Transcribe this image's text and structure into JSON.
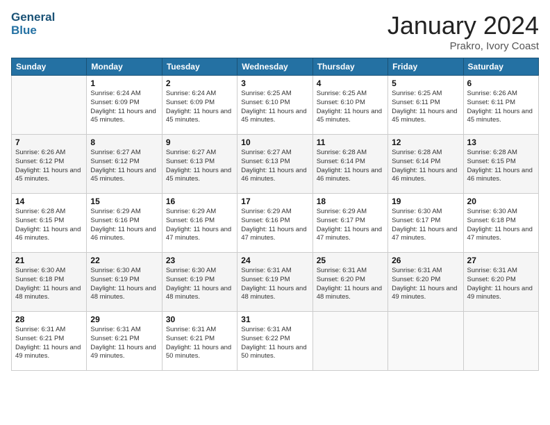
{
  "header": {
    "logo_line1": "General",
    "logo_line2": "Blue",
    "month_title": "January 2024",
    "subtitle": "Prakro, Ivory Coast"
  },
  "columns": [
    "Sunday",
    "Monday",
    "Tuesday",
    "Wednesday",
    "Thursday",
    "Friday",
    "Saturday"
  ],
  "weeks": [
    [
      {
        "day": "",
        "info": ""
      },
      {
        "day": "1",
        "info": "Sunrise: 6:24 AM\nSunset: 6:09 PM\nDaylight: 11 hours and 45 minutes."
      },
      {
        "day": "2",
        "info": "Sunrise: 6:24 AM\nSunset: 6:09 PM\nDaylight: 11 hours and 45 minutes."
      },
      {
        "day": "3",
        "info": "Sunrise: 6:25 AM\nSunset: 6:10 PM\nDaylight: 11 hours and 45 minutes."
      },
      {
        "day": "4",
        "info": "Sunrise: 6:25 AM\nSunset: 6:10 PM\nDaylight: 11 hours and 45 minutes."
      },
      {
        "day": "5",
        "info": "Sunrise: 6:25 AM\nSunset: 6:11 PM\nDaylight: 11 hours and 45 minutes."
      },
      {
        "day": "6",
        "info": "Sunrise: 6:26 AM\nSunset: 6:11 PM\nDaylight: 11 hours and 45 minutes."
      }
    ],
    [
      {
        "day": "7",
        "info": "Sunrise: 6:26 AM\nSunset: 6:12 PM\nDaylight: 11 hours and 45 minutes."
      },
      {
        "day": "8",
        "info": "Sunrise: 6:27 AM\nSunset: 6:12 PM\nDaylight: 11 hours and 45 minutes."
      },
      {
        "day": "9",
        "info": "Sunrise: 6:27 AM\nSunset: 6:13 PM\nDaylight: 11 hours and 45 minutes."
      },
      {
        "day": "10",
        "info": "Sunrise: 6:27 AM\nSunset: 6:13 PM\nDaylight: 11 hours and 46 minutes."
      },
      {
        "day": "11",
        "info": "Sunrise: 6:28 AM\nSunset: 6:14 PM\nDaylight: 11 hours and 46 minutes."
      },
      {
        "day": "12",
        "info": "Sunrise: 6:28 AM\nSunset: 6:14 PM\nDaylight: 11 hours and 46 minutes."
      },
      {
        "day": "13",
        "info": "Sunrise: 6:28 AM\nSunset: 6:15 PM\nDaylight: 11 hours and 46 minutes."
      }
    ],
    [
      {
        "day": "14",
        "info": "Sunrise: 6:28 AM\nSunset: 6:15 PM\nDaylight: 11 hours and 46 minutes."
      },
      {
        "day": "15",
        "info": "Sunrise: 6:29 AM\nSunset: 6:16 PM\nDaylight: 11 hours and 46 minutes."
      },
      {
        "day": "16",
        "info": "Sunrise: 6:29 AM\nSunset: 6:16 PM\nDaylight: 11 hours and 47 minutes."
      },
      {
        "day": "17",
        "info": "Sunrise: 6:29 AM\nSunset: 6:16 PM\nDaylight: 11 hours and 47 minutes."
      },
      {
        "day": "18",
        "info": "Sunrise: 6:29 AM\nSunset: 6:17 PM\nDaylight: 11 hours and 47 minutes."
      },
      {
        "day": "19",
        "info": "Sunrise: 6:30 AM\nSunset: 6:17 PM\nDaylight: 11 hours and 47 minutes."
      },
      {
        "day": "20",
        "info": "Sunrise: 6:30 AM\nSunset: 6:18 PM\nDaylight: 11 hours and 47 minutes."
      }
    ],
    [
      {
        "day": "21",
        "info": "Sunrise: 6:30 AM\nSunset: 6:18 PM\nDaylight: 11 hours and 48 minutes."
      },
      {
        "day": "22",
        "info": "Sunrise: 6:30 AM\nSunset: 6:19 PM\nDaylight: 11 hours and 48 minutes."
      },
      {
        "day": "23",
        "info": "Sunrise: 6:30 AM\nSunset: 6:19 PM\nDaylight: 11 hours and 48 minutes."
      },
      {
        "day": "24",
        "info": "Sunrise: 6:31 AM\nSunset: 6:19 PM\nDaylight: 11 hours and 48 minutes."
      },
      {
        "day": "25",
        "info": "Sunrise: 6:31 AM\nSunset: 6:20 PM\nDaylight: 11 hours and 48 minutes."
      },
      {
        "day": "26",
        "info": "Sunrise: 6:31 AM\nSunset: 6:20 PM\nDaylight: 11 hours and 49 minutes."
      },
      {
        "day": "27",
        "info": "Sunrise: 6:31 AM\nSunset: 6:20 PM\nDaylight: 11 hours and 49 minutes."
      }
    ],
    [
      {
        "day": "28",
        "info": "Sunrise: 6:31 AM\nSunset: 6:21 PM\nDaylight: 11 hours and 49 minutes."
      },
      {
        "day": "29",
        "info": "Sunrise: 6:31 AM\nSunset: 6:21 PM\nDaylight: 11 hours and 49 minutes."
      },
      {
        "day": "30",
        "info": "Sunrise: 6:31 AM\nSunset: 6:21 PM\nDaylight: 11 hours and 50 minutes."
      },
      {
        "day": "31",
        "info": "Sunrise: 6:31 AM\nSunset: 6:22 PM\nDaylight: 11 hours and 50 minutes."
      },
      {
        "day": "",
        "info": ""
      },
      {
        "day": "",
        "info": ""
      },
      {
        "day": "",
        "info": ""
      }
    ]
  ]
}
